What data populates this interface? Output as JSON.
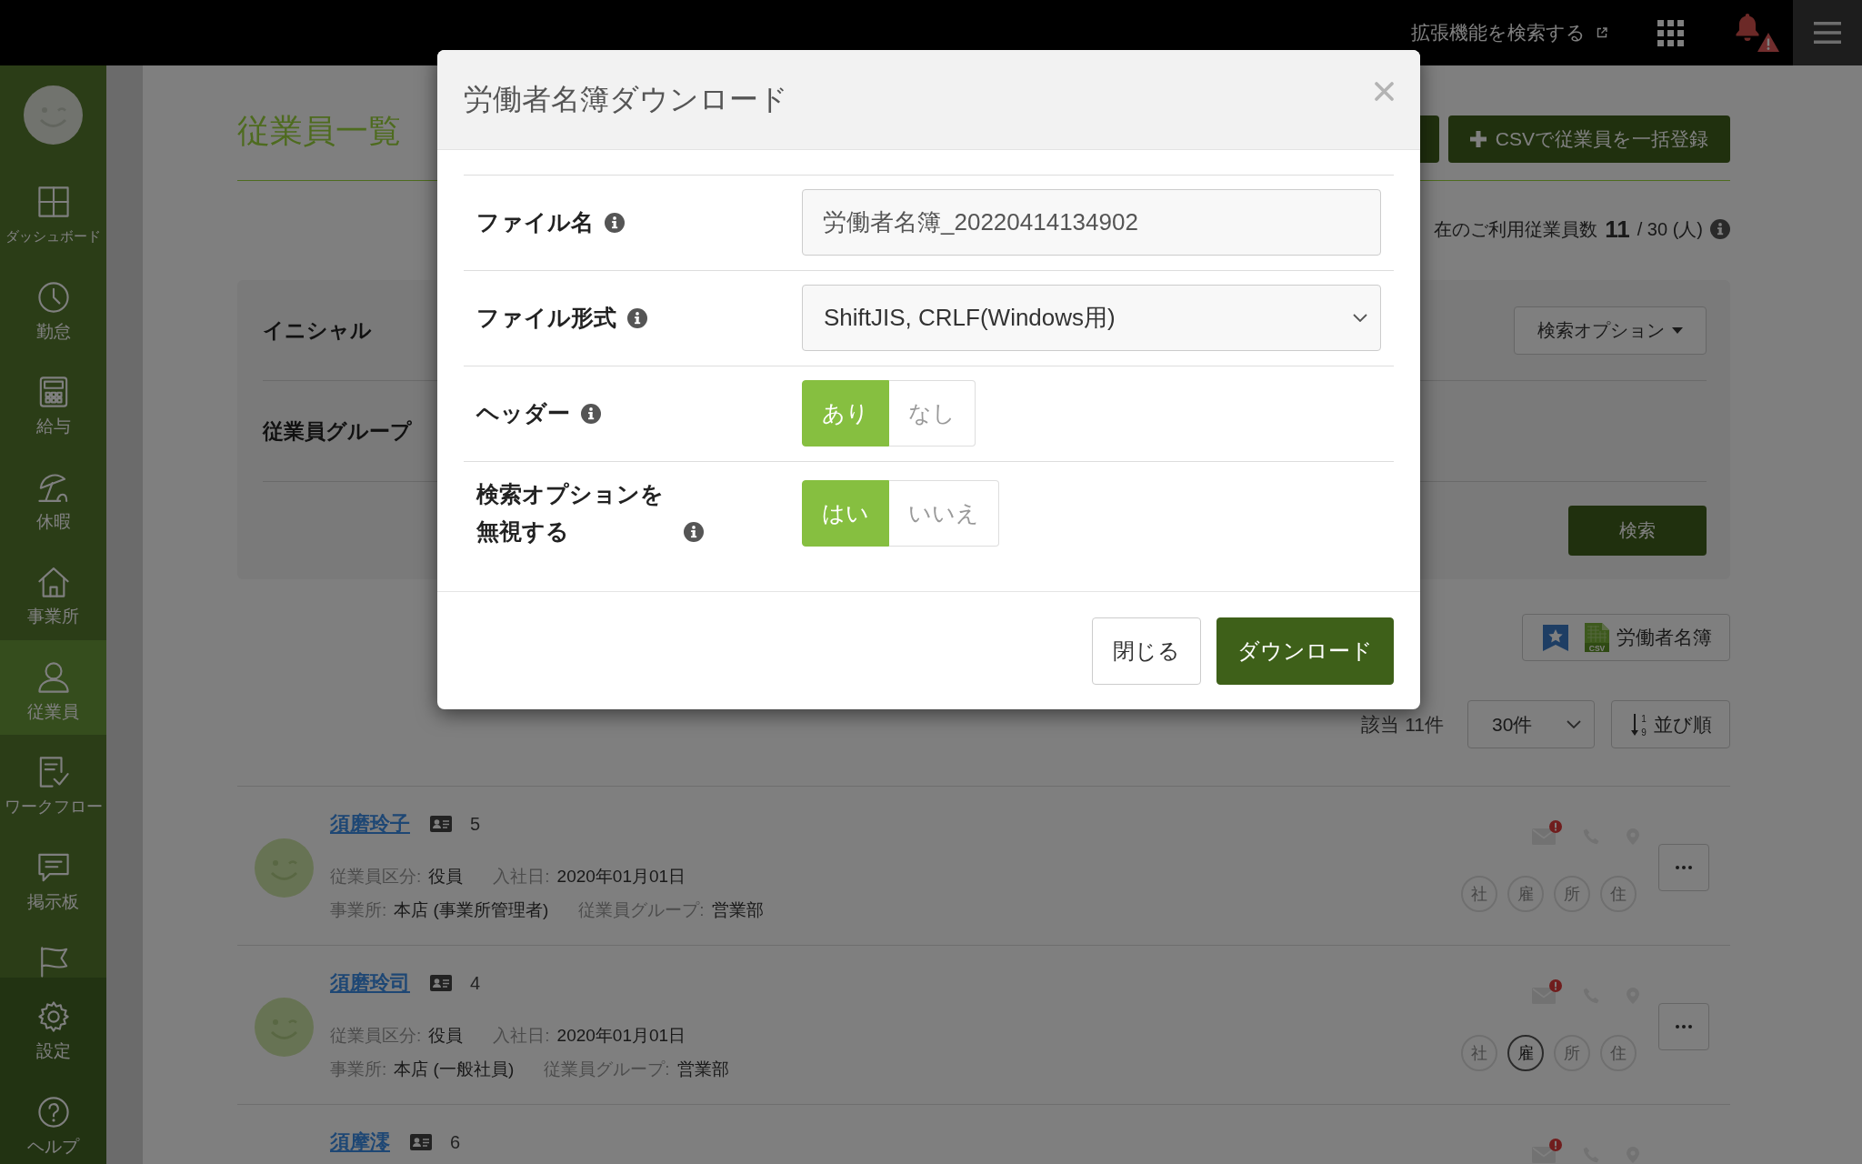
{
  "top_bar": {
    "extension_link": "拡張機能を検索する",
    "alert": true
  },
  "sidebar": {
    "items": [
      {
        "label": "ダッシュボード",
        "selected": false
      },
      {
        "label": "勤怠",
        "selected": false
      },
      {
        "label": "給与",
        "selected": false
      },
      {
        "label": "休暇",
        "selected": false
      },
      {
        "label": "事業所",
        "selected": false
      },
      {
        "label": "従業員",
        "selected": true
      },
      {
        "label": "ワークフロー",
        "selected": false
      },
      {
        "label": "掲示板",
        "selected": false
      },
      {
        "selected": false
      }
    ],
    "bottom_items": [
      {
        "label": "設定",
        "selected": false
      },
      {
        "label": "ヘルプ",
        "selected": false
      }
    ]
  },
  "page": {
    "title": "従業員一覧",
    "header_buttons": [
      {
        "kind": "plain"
      },
      {
        "kind": "add",
        "label": "CSVで従業員を一括登録"
      }
    ],
    "usage": {
      "label": "在のご利用従業員数",
      "count": "11",
      "limit": "/ 30 (人)"
    },
    "search_panel": {
      "rows": [
        {
          "label": "イニシャル"
        },
        {
          "label": "従業員グループ"
        }
      ],
      "options_button": "検索オプション",
      "search_button": "検索"
    },
    "roster_button": {
      "badge": "CSV",
      "label": "労働者名簿"
    },
    "results": {
      "count": "該当 11件",
      "per_page": "30件",
      "sort": {
        "digits": [
          "1",
          "9"
        ],
        "label": "並び順"
      }
    },
    "employees": [
      {
        "name": "須磨玲子",
        "number": "5",
        "mail_alert": true,
        "lines": [
          [
            {
              "label": "従業員区分:",
              "value": "役員"
            },
            {
              "label": "入社日:",
              "value": "2020年01月01日"
            }
          ],
          [
            {
              "label": "事業所:",
              "value": "本店 (事業所管理者)"
            },
            {
              "label": "従業員グループ:",
              "value": "営業部"
            }
          ]
        ],
        "badges": [
          {
            "label": "社",
            "active": false
          },
          {
            "label": "雇",
            "active": false
          },
          {
            "label": "所",
            "active": false
          },
          {
            "label": "住",
            "active": false
          }
        ],
        "menu_button": true
      },
      {
        "name": "須磨玲司",
        "number": "4",
        "mail_alert": true,
        "lines": [
          [
            {
              "label": "従業員区分:",
              "value": "役員"
            },
            {
              "label": "入社日:",
              "value": "2020年01月01日"
            }
          ],
          [
            {
              "label": "事業所:",
              "value": "本店 (一般社員)"
            },
            {
              "label": "従業員グループ:",
              "value": "営業部"
            }
          ]
        ],
        "badges": [
          {
            "label": "社",
            "active": false
          },
          {
            "label": "雇",
            "active": true
          },
          {
            "label": "所",
            "active": false
          },
          {
            "label": "住",
            "active": false
          }
        ],
        "menu_button": true
      },
      {
        "name": "須摩澪",
        "number": "6",
        "mail_alert": true
      }
    ]
  },
  "dialog": {
    "title": "労働者名簿ダウンロード",
    "fields": [
      {
        "kind": "text",
        "label": "ファイル名",
        "value": "労働者名簿_20220414134902"
      },
      {
        "kind": "select",
        "label": "ファイル形式",
        "value": "ShiftJIS, CRLF(Windows用)"
      },
      {
        "kind": "toggle",
        "label": "ヘッダー",
        "options": [
          {
            "label": "あり",
            "selected": true
          },
          {
            "label": "なし",
            "selected": false
          }
        ]
      },
      {
        "kind": "toggle",
        "label": "検索オプションを無視する",
        "options": [
          {
            "label": "はい",
            "selected": true
          },
          {
            "label": "いいえ",
            "selected": false
          }
        ]
      }
    ],
    "buttons": [
      {
        "kind": "secondary",
        "label": "閉じる"
      },
      {
        "kind": "primary",
        "label": "ダウンロード"
      }
    ]
  }
}
